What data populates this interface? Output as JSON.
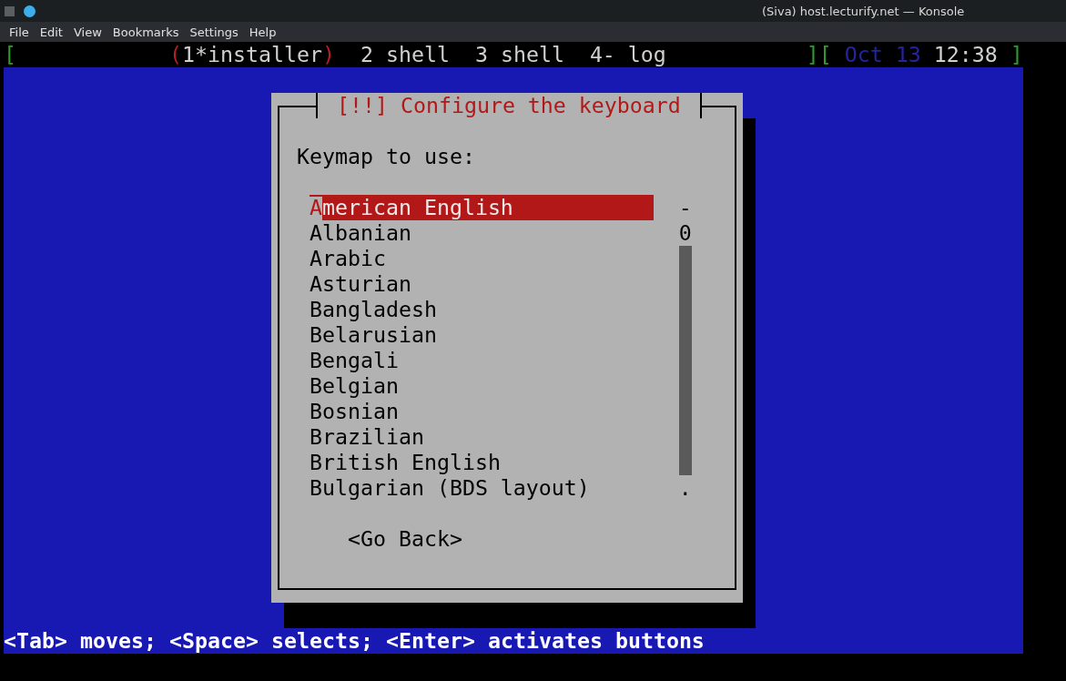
{
  "window": {
    "title": "(Siva) host.lecturify.net — Konsole"
  },
  "menu": [
    "File",
    "Edit",
    "View",
    "Bookmarks",
    "Settings",
    "Help"
  ],
  "status_line": {
    "open_bracket": "[",
    "current_marks": {
      "open": "(",
      "close": ")"
    },
    "windows": [
      {
        "label": "1*installer",
        "selected": true
      },
      {
        "label": "2 shell",
        "selected": false
      },
      {
        "label": "3 shell",
        "selected": false
      },
      {
        "label": "4- log",
        "selected": false
      }
    ],
    "separator": "][",
    "date": "Oct 13",
    "time": "12:38",
    "close_bracket": "]"
  },
  "dialog": {
    "title": "[!!] Configure the keyboard",
    "prompt": "Keymap to use:",
    "items": [
      {
        "label": "American English",
        "selected": true
      },
      {
        "label": "Albanian",
        "selected": false
      },
      {
        "label": "Arabic",
        "selected": false
      },
      {
        "label": "Asturian",
        "selected": false
      },
      {
        "label": "Bangladesh",
        "selected": false
      },
      {
        "label": "Belarusian",
        "selected": false
      },
      {
        "label": "Bengali",
        "selected": false
      },
      {
        "label": "Belgian",
        "selected": false
      },
      {
        "label": "Bosnian",
        "selected": false
      },
      {
        "label": "Brazilian",
        "selected": false
      },
      {
        "label": "British English",
        "selected": false
      },
      {
        "label": "Bulgarian (BDS layout)",
        "selected": false
      }
    ],
    "scrollbar": {
      "top_mark": "-",
      "second_mark": "0",
      "bottom_mark": "."
    },
    "button": "<Go Back>"
  },
  "help_line": "<Tab> moves; <Space> selects; <Enter> activates buttons"
}
